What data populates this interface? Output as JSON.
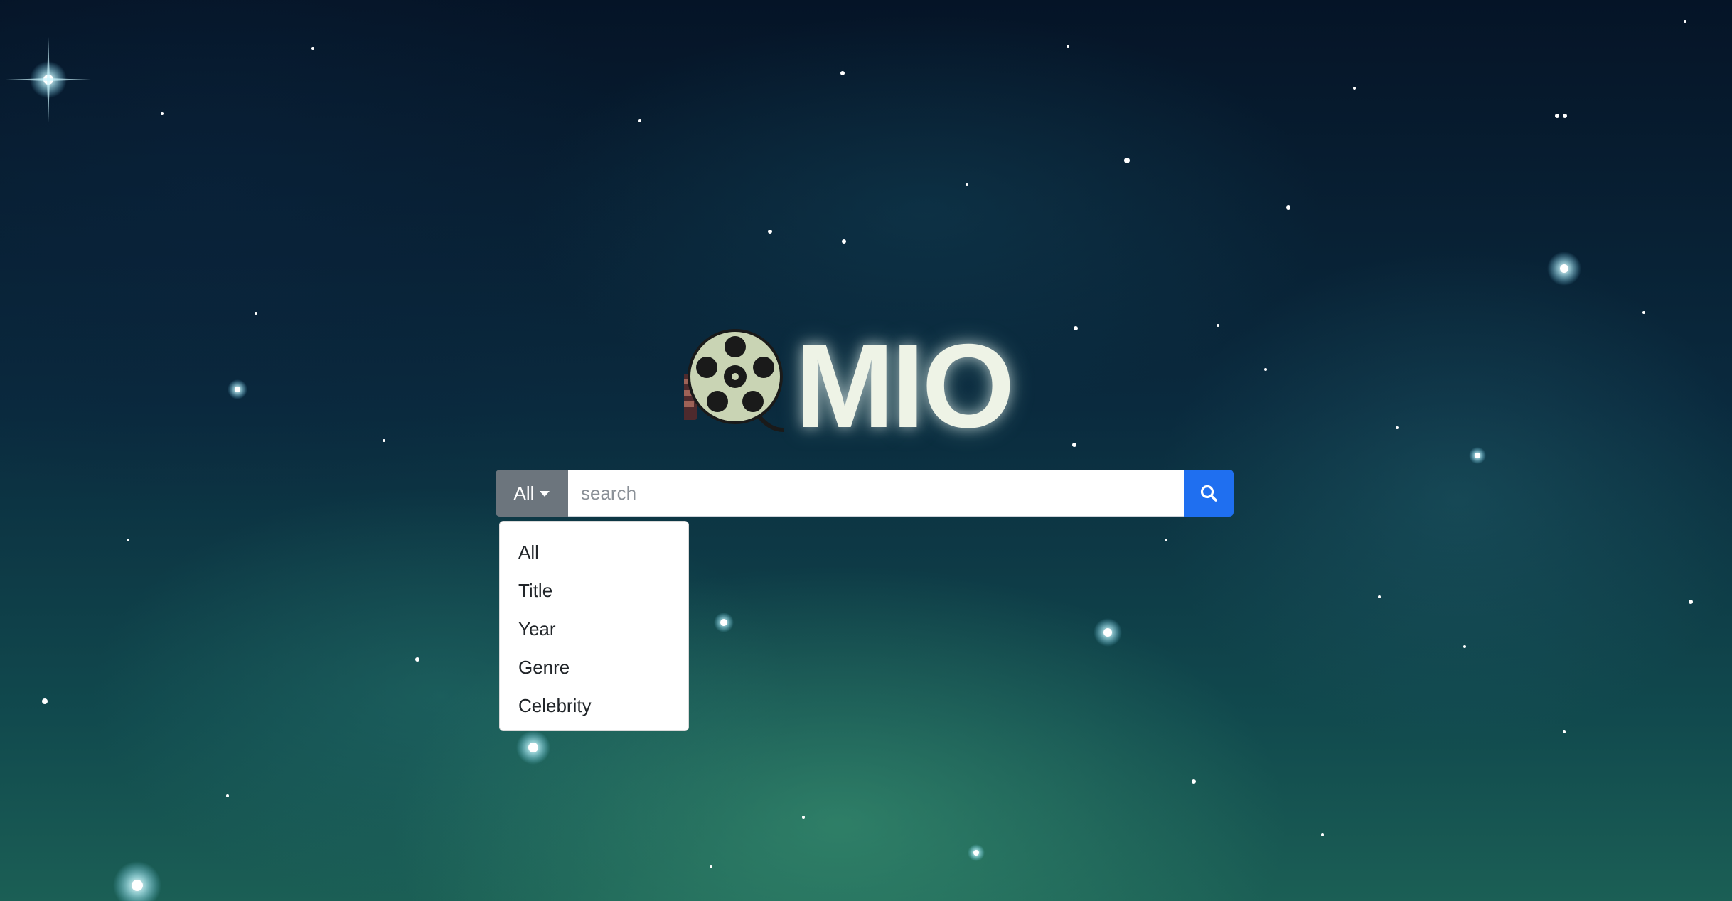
{
  "logo": {
    "text": "MIO",
    "icon": "film-reel-icon"
  },
  "search": {
    "filter_label": "All",
    "placeholder": "search",
    "value": "",
    "button_icon": "search-icon"
  },
  "dropdown": {
    "items": [
      {
        "label": "All"
      },
      {
        "label": "Title"
      },
      {
        "label": "Year"
      },
      {
        "label": "Genre"
      },
      {
        "label": "Celebrity"
      }
    ]
  },
  "colors": {
    "filter_bg": "#6c757d",
    "search_button_bg": "#1f6ff0",
    "logo_text": "#eef3e6",
    "reel": "#c9d4b4"
  }
}
